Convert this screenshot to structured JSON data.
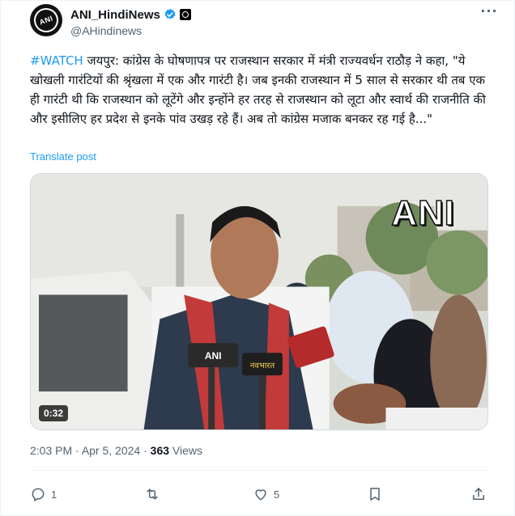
{
  "account": {
    "display_name": "ANI_HindiNews",
    "handle": "@AHindinews",
    "avatar_text": "ANI"
  },
  "tweet": {
    "hashtag": "#WATCH",
    "body": " जयपुर: कांग्रेस के घोषणापत्र पर राजस्थान सरकार में मंत्री राज्यवर्धन राठौड़ ने कहा, \"ये खोखली गारंटियों की श्रृंखला में एक और गारंटी है। जब इनकी राजस्थान में 5 साल से सरकार थी तब एक ही गारंटी थी कि राजस्थान को लूटेंगे और इन्होंने हर तरह से राजस्थान को लूटा और स्वार्थ की राजनीति की और इसीलिए हर प्रदेश से इनके पांव उखड़ रहे हैं। अब तो कांग्रेस मजाक बनकर रह गई है...\"",
    "translate_label": "Translate post"
  },
  "media": {
    "watermark": "ANI",
    "duration": "0:32",
    "mic_labels": [
      "ANI",
      "नवभारत"
    ]
  },
  "meta": {
    "time": "2:03 PM",
    "separator": " · ",
    "date": "Apr 5, 2024",
    "views_count": "363",
    "views_label": " Views"
  },
  "actions": {
    "reply_count": "1",
    "repost_count": "",
    "like_count": "5"
  },
  "colors": {
    "accent": "#1d9bf0",
    "muted": "#536471"
  }
}
